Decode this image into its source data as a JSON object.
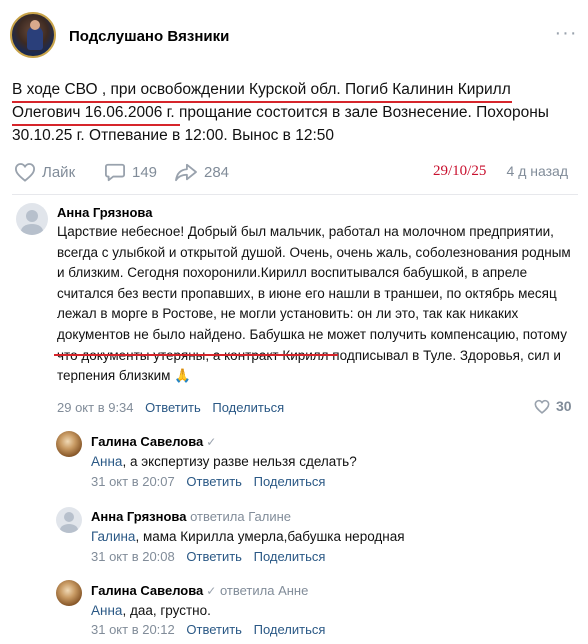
{
  "post": {
    "group_name": "Подслушано Вязники",
    "text": "В ходе СВО , при освобождении Курской обл. Погиб Калинин Кирилл Олегович 16.06.2006 г. прощание состоится в зале Вознесение. Похороны 30.10.25 г. Отпевание в 12:00. Вынос в 12:50",
    "like_label": "Лайк",
    "comments_count": "149",
    "shares_count": "284",
    "stamp_date": "29/10/25",
    "time": "4 д назад",
    "icons": [
      "more-icon",
      "heart-icon",
      "comment-icon",
      "share-icon"
    ]
  },
  "comments": [
    {
      "author": "Анна Грязнова",
      "text": "Царствие небесное! Добрый был мальчик, работал на молочном предприятии, всегда с улыбкой и открытой душой. Очень, очень жаль, соболезнования родным и близким. Сегодня похоронили.Кирилл воспитывался бабушкой, в апреле считался без вести пропавших, в июне его нашли в траншеи, по октябрь месяц лежал в морге в Ростове, не могли установить: он ли это, так как никаких документов не было найдено. Бабушка не может получить компенсацию, потому что документы утеряны, а контракт Кирилл подписывал в Туле. Здоровья, сил и терпения близким",
      "emoji": "🙏",
      "date": "29 окт в 9:34",
      "reply_label": "Ответить",
      "share_label": "Поделиться",
      "likes": "30"
    }
  ],
  "replies": [
    {
      "author": "Галина Савелова",
      "reply_to": "",
      "addressee": "Анна",
      "text": ", а экспертизу разве нельзя сделать?",
      "date": "31 окт в 20:07",
      "reply_label": "Ответить",
      "share_label": "Поделиться"
    },
    {
      "author": "Анна Грязнова",
      "reply_to": "ответила Галине",
      "addressee": "Галина",
      "text": ", мама Кирилла умерла,бабушка неродная",
      "date": "31 окт в 20:08",
      "reply_label": "Ответить",
      "share_label": "Поделиться"
    },
    {
      "author": "Галина Савелова",
      "reply_to": "ответила Анне",
      "addressee": "Анна",
      "text": ", даа, грустно.",
      "date": "31 окт в 20:12",
      "reply_label": "Ответить",
      "share_label": "Поделиться"
    }
  ],
  "colors": {
    "link": "#2a5885",
    "muted": "#818c99",
    "underline": "#d6252b",
    "stamp": "#c8102e"
  }
}
